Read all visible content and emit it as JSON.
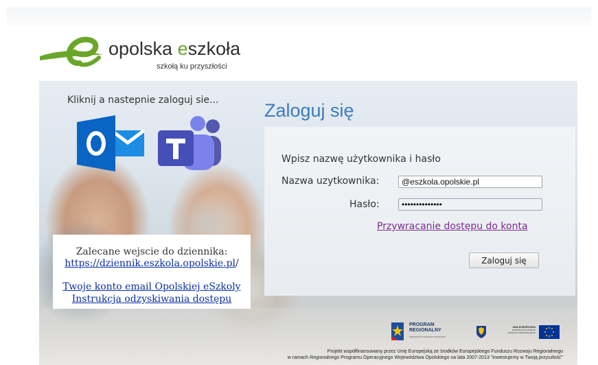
{
  "brand": {
    "name_part1": "opolska ",
    "name_e": "e",
    "name_part2": "szkoła",
    "tagline": "szkołą ku przyszłości"
  },
  "left_panel": {
    "hint": "Kliknij a nastepnie zaloguj sie...",
    "apps": [
      {
        "name": "Outlook",
        "icon": "outlook-icon",
        "letter": "O"
      },
      {
        "name": "Teams",
        "icon": "teams-icon",
        "letter": "T"
      }
    ],
    "note": {
      "line1": "Zalecane wejscie do dziennika:",
      "link_url": "https://dziennik.eszkola.opolskie.pl",
      "link_suffix": "/",
      "link_email": "Twoje konto email Opolskiej eSzkoly",
      "link_recovery": "Instrukcja odzyskiwania dostępu"
    }
  },
  "login": {
    "title": "Zaloguj się",
    "instruction": "Wpisz nazwę użytkownika i hasło",
    "username_label": "Nazwa uzytkownika:",
    "username_value": "@eszkola.opolskie.pl",
    "password_label": "Hasło:",
    "password_value": "••••••••••••••",
    "recover_link": "Przywracanie dostępu do konta",
    "submit_label": "Zaloguj się"
  },
  "footer": {
    "logos": {
      "program_line1": "PROGRAM",
      "program_line2": "REGIONALNY",
      "program_line3": "NARODOWA STRATEGIA SPÓJNOŚCI",
      "eu_line1": "UNIA EUROPEJSKA",
      "eu_line2": "EUROPEJSKI FUNDUSZ",
      "eu_line3": "ROZWOJU REGIONALNEGO"
    },
    "line1": "Projekt współfinansowany przez Unię Europejską ze środków Europejskiego Funduszu Rozwoju Regionalnego",
    "line2": "w ramach Regionalnego Programu Operacyjnego Województwa Opolskiego na lata 2007-2013 \"inwestujemy w Twoją przyszłość\""
  },
  "colors": {
    "brand_green": "#6aa629",
    "title_blue": "#3a7cc0",
    "link_blue": "#0a2fa3",
    "visited_purple": "#7b2c8f",
    "outlook_blue": "#0a64c3",
    "teams_purple": "#5558af"
  }
}
